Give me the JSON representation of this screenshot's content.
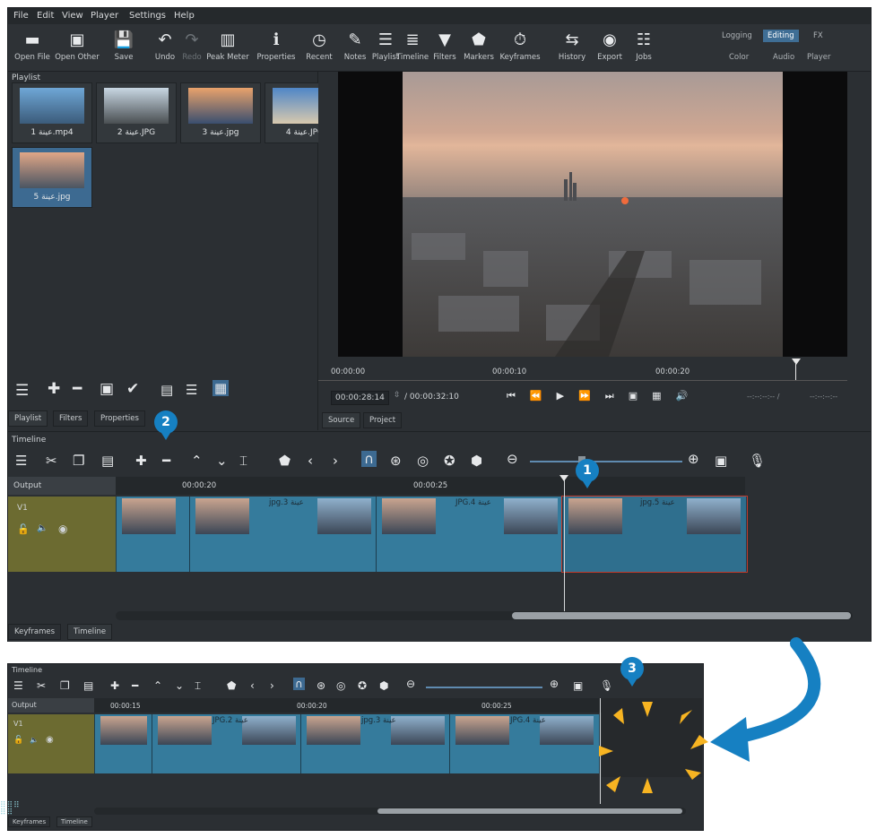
{
  "menu": [
    "File",
    "Edit",
    "View",
    "Player",
    "Settings",
    "Help"
  ],
  "toolbar": [
    {
      "label": "Open File",
      "icon": "folder-open-icon",
      "glyph": "▬"
    },
    {
      "label": "Open Other",
      "icon": "open-other-icon",
      "glyph": "▣"
    },
    {
      "label": "Save",
      "icon": "save-icon",
      "glyph": "💾"
    },
    {
      "label": "Undo",
      "icon": "undo-icon",
      "glyph": "↶"
    },
    {
      "label": "Redo",
      "icon": "redo-icon",
      "glyph": "↷"
    },
    {
      "label": "Peak Meter",
      "icon": "peak-meter-icon",
      "glyph": "▥"
    },
    {
      "label": "Properties",
      "icon": "info-icon",
      "glyph": "ℹ"
    },
    {
      "label": "Recent",
      "icon": "clock-icon",
      "glyph": "◷"
    },
    {
      "label": "Notes",
      "icon": "notes-icon",
      "glyph": "✎"
    },
    {
      "label": "Playlist",
      "icon": "playlist-icon",
      "glyph": "☰"
    },
    {
      "label": "Timeline",
      "icon": "timeline-icon",
      "glyph": "≣"
    },
    {
      "label": "Filters",
      "icon": "filter-icon",
      "glyph": "▼"
    },
    {
      "label": "Markers",
      "icon": "marker-icon",
      "glyph": "⬟"
    },
    {
      "label": "Keyframes",
      "icon": "stopwatch-icon",
      "glyph": "⏱"
    },
    {
      "label": "History",
      "icon": "history-icon",
      "glyph": "⇆"
    },
    {
      "label": "Export",
      "icon": "export-icon",
      "glyph": "◉"
    },
    {
      "label": "Jobs",
      "icon": "jobs-icon",
      "glyph": "☷"
    }
  ],
  "workspaces": {
    "logging": "Logging",
    "editing": "Editing",
    "fx": "FX",
    "color": "Color",
    "audio": "Audio",
    "player": "Player"
  },
  "playlist": {
    "title": "Playlist",
    "items": [
      {
        "caption": "1 عينة.mp4",
        "colors": [
          "#6fa7d6",
          "#3b5b7a"
        ]
      },
      {
        "caption": "2 عينة.JPG",
        "colors": [
          "#c8d7e3",
          "#4a4f52"
        ]
      },
      {
        "caption": "3 عينة.jpg",
        "colors": [
          "#e9a26b",
          "#3a4e6f"
        ]
      },
      {
        "caption": "4 عينة.JPG",
        "colors": [
          "#4f86c7",
          "#d8c9ae"
        ]
      },
      {
        "caption": "5 عينة.jpg",
        "colors": [
          "#e0a687",
          "#4a5562"
        ]
      }
    ]
  },
  "tabs_left": [
    "Playlist",
    "Filters",
    "Properties"
  ],
  "tabs_player": [
    "Source",
    "Project"
  ],
  "player": {
    "ruler": [
      "00:00:00",
      "00:00:10",
      "00:00:20"
    ],
    "timecode": "00:00:28:14",
    "duration": "/ 00:00:32:10",
    "in_point": "--:--:--:-- /",
    "out_point": "--:--:--:--"
  },
  "timeline": {
    "title": "Timeline",
    "output_label": "Output",
    "track_label": "V1",
    "ruler": [
      "00:00:20",
      "00:00:25"
    ],
    "clips": [
      {
        "label": ""
      },
      {
        "label": "jpg.3 عينة"
      },
      {
        "label": "JPG.4 عينة"
      },
      {
        "label": "jpg.5 عينة"
      }
    ],
    "bottom_tabs": [
      "Keyframes",
      "Timeline"
    ]
  },
  "timeline2": {
    "title": "Timeline",
    "output_label": "Output",
    "track_label": "V1",
    "ruler": [
      "00:00:15",
      "00:00:20",
      "00:00:25"
    ],
    "clips": [
      {
        "label": ""
      },
      {
        "label": "JPG.2 عينة"
      },
      {
        "label": "jpg.3 عينة"
      },
      {
        "label": "JPG.4 عينة"
      }
    ],
    "bottom_tabs": [
      "Keyframes",
      "Timeline"
    ]
  },
  "badges": {
    "one": "1",
    "two": "2",
    "three": "3"
  },
  "accent": "#1680c2"
}
